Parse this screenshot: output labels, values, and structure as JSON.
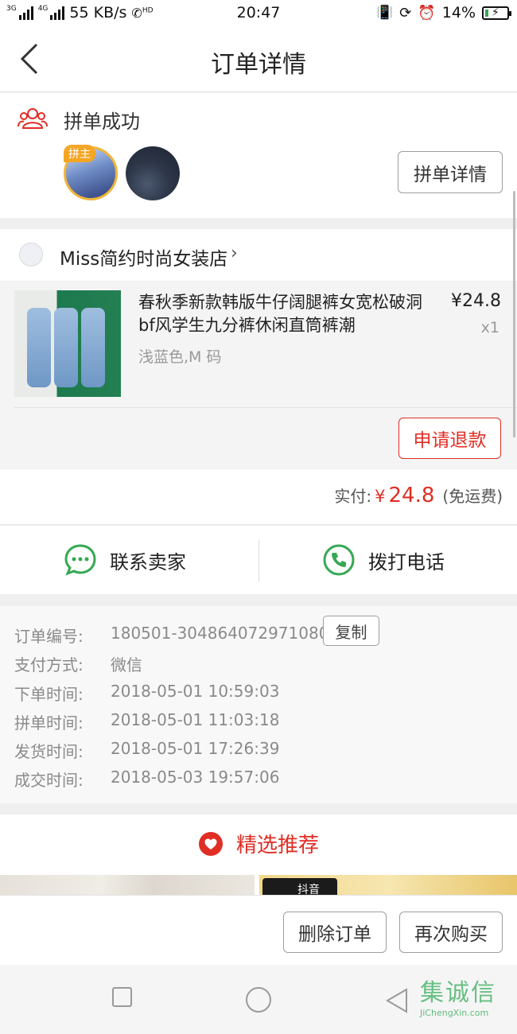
{
  "statusbar": {
    "net_label_1": "3G",
    "net_label_2": "4G",
    "speed": "55 KB/s",
    "call_label": "HD",
    "time": "20:47",
    "battery": "14%",
    "battery_level": 0.14
  },
  "nav": {
    "title": "订单详情"
  },
  "group": {
    "status": "拼单成功",
    "owner_badge": "拼主",
    "detail_button": "拼单详情"
  },
  "shop": {
    "name": "Miss简约时尚女装店",
    "arrow": "›"
  },
  "goods": {
    "name": "春秋季新款韩版牛仔阔腿裤女宽松破洞bf风学生九分裤休闲直筒裤潮",
    "sku": "浅蓝色,M 码",
    "price": "¥24.8",
    "qty": "x1",
    "refund_button": "申请退款"
  },
  "payment": {
    "label": "实付:",
    "currency": "¥",
    "amount": "24.8",
    "note": "(免运费)"
  },
  "contact": {
    "seller": "联系卖家",
    "phone": "拨打电话"
  },
  "order_info": {
    "copy_button": "复制",
    "rows": [
      {
        "key": "订单编号:",
        "value": "180501-304864072971080"
      },
      {
        "key": "支付方式:",
        "value": "微信"
      },
      {
        "key": "下单时间:",
        "value": "2018-05-01 10:59:03"
      },
      {
        "key": "拼单时间:",
        "value": "2018-05-01 11:03:18"
      },
      {
        "key": "发货时间:",
        "value": "2018-05-01 17:26:39"
      },
      {
        "key": "成交时间:",
        "value": "2018-05-03 19:57:06"
      }
    ]
  },
  "recommend": {
    "title": "精选推荐",
    "tiktok_label": "抖音"
  },
  "bottom": {
    "delete_button": "删除订单",
    "rebuy_button": "再次购买"
  },
  "watermark": {
    "logo": "集诚信",
    "url": "JiChengXin.com"
  },
  "colors": {
    "accent": "#e02e24",
    "green": "#35a853",
    "badge": "#f5a623"
  },
  "icons": {
    "group": "group-people-icon",
    "chat": "chat-bubble-icon",
    "phone": "phone-icon",
    "heart": "heart-icon",
    "back": "back-arrow-icon"
  }
}
